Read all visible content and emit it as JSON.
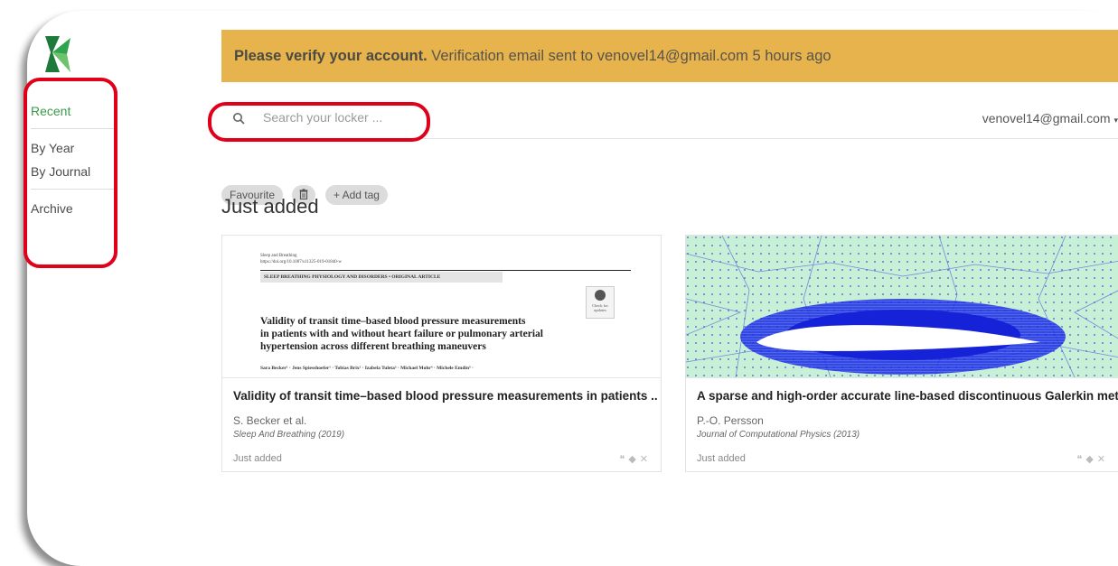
{
  "sidebar": {
    "items": [
      {
        "label": "Recent",
        "active": true
      },
      {
        "label": "By Year"
      },
      {
        "label": "By Journal"
      },
      {
        "label": "Archive"
      }
    ]
  },
  "banner": {
    "bold": "Please verify your account.",
    "text": " Verification email sent to venovel14@gmail.com 5 hours ago",
    "color": "#e6b34c"
  },
  "search": {
    "placeholder": "Search your locker ..."
  },
  "user": {
    "email": "venovel14@gmail.com"
  },
  "chips": {
    "favourite": "Favourite",
    "add_tag": "+ Add tag"
  },
  "section": {
    "title": "Just added"
  },
  "cards": [
    {
      "title": "Validity of transit time–based blood pressure measurements in patients ...",
      "author": "S. Becker et al.",
      "journal": "Sleep And Breathing (2019)",
      "status": "Just added",
      "thumb": {
        "journal": "Sleep and Breathing",
        "doi": "https://doi.org/10.1007/s11325-019-01840-w",
        "category": "SLEEP BREATHING PHYSIOLOGY AND DISORDERS • ORIGINAL ARTICLE",
        "check": "Check for updates",
        "title_lines": [
          "Validity of transit time–based blood pressure measurements",
          "in patients with and without heart failure or pulmonary arterial",
          "hypertension across different breathing maneuvers"
        ],
        "authors": "Sara Becker¹ · Jens Spiesshoefer¹ · Tobias Brix² · Izabela Tuleta³ · Michael Mohr⁴ · Michele Emdin⁵ ·"
      }
    },
    {
      "title": "A sparse and high-order accurate line-based discontinuous Galerkin met...",
      "author": "P.-O. Persson",
      "journal": "Journal of Computational Physics (2013)",
      "status": "Just added"
    }
  ],
  "accent": "#3c9a4a",
  "highlight": "#e0001a"
}
